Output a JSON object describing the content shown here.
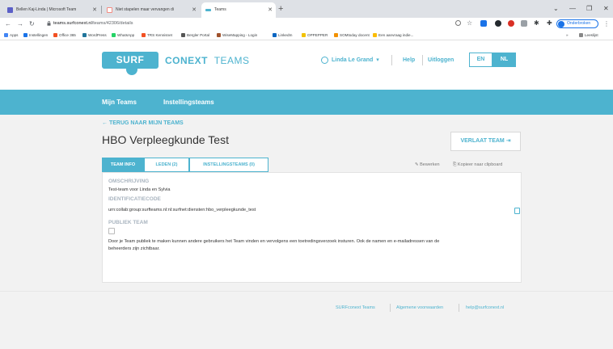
{
  "browser": {
    "tabs": [
      {
        "title": "Bellen Kaj-Linda | Microsoft Team",
        "favicon_color": "#5b5fc7"
      },
      {
        "title": "Niet stapelen maar vervangen di",
        "favicon_color": "#f28b82"
      },
      {
        "title": "Teams",
        "favicon_color": "#4db3cf"
      }
    ],
    "new_tab": "+",
    "url_host": "teams.surfconext.nl",
    "url_path": "/teams/42306/details",
    "profile_label": "Onderbroken",
    "bookmarks": [
      {
        "label": "Apps",
        "color": "#4285f4"
      },
      {
        "label": "Instellingen",
        "color": "#1a73e8"
      },
      {
        "label": "Office 365",
        "color": "#f25022"
      },
      {
        "label": "WordPress",
        "color": "#21759b"
      },
      {
        "label": "WhatsApp",
        "color": "#25d366"
      },
      {
        "label": "TRS Kennisnet",
        "color": "#f25022"
      },
      {
        "label": "Bergler Portal",
        "color": "#555555"
      },
      {
        "label": "WiseMapping - Login",
        "color": "#a0522d"
      },
      {
        "label": "LinkedIn",
        "color": "#0a66c2"
      },
      {
        "label": "OPPEPPER",
        "color": "#f2c200"
      },
      {
        "label": "SOMtoday docent",
        "color": "#f29100"
      },
      {
        "label": "Een aanvraag indie...",
        "color": "#fbbc04"
      }
    ],
    "bookmarks_more": "»",
    "reading_list": "Leeslijst"
  },
  "header": {
    "logo_box": "SURF",
    "logo_text_1": "CONEXT",
    "logo_text_2": "TEAMS",
    "user_name": "Linda Le Grand",
    "user_caret": "▾",
    "help": "Help",
    "logout": "Uitloggen",
    "lang_en": "EN",
    "lang_nl": "NL"
  },
  "nav": {
    "my_teams": "Mijn Teams",
    "institution_teams": "Instellingsteams"
  },
  "team": {
    "back_link": "← TERUG NAAR MIJN TEAMS",
    "title": "HBO Verpleegkunde Test",
    "leave_button": "VERLAAT TEAM ⇥",
    "tabs": [
      "TEAM INFO",
      "LEDEN (2)",
      "INSTELLINGSTEAMS (0)"
    ],
    "edit_action": "✎ Bewerken",
    "copy_action": "⎘ Kopieer naar clipboard"
  },
  "details": {
    "description_label": "OMSCHRIJVING",
    "description_value": "Test-team voor Linda en Sylvia",
    "identifier_label": "IDENTIFICATIECODE",
    "identifier_value": "urn:collab:group:surfteams.nl:nl:surfnet:diensten:hbo_verpleegkunde_test",
    "public_label": "PUBLIEK TEAM",
    "public_checked": false,
    "public_text_line1": "Door je Team publiek te maken kunnen andere gebruikers het Team vinden en vervolgens een toetredingsverzoek insturen. Ook de namen en e-mailadressen van de",
    "public_text_line2": "beheerders zijn zichtbaar."
  },
  "footer": {
    "link1": "SURFconext Teams",
    "link2": "Algemene voorwaarden",
    "link3": "help@surfconext.nl"
  },
  "colors": {
    "accent": "#4db3cf",
    "page_bg": "#f2f2f2"
  }
}
